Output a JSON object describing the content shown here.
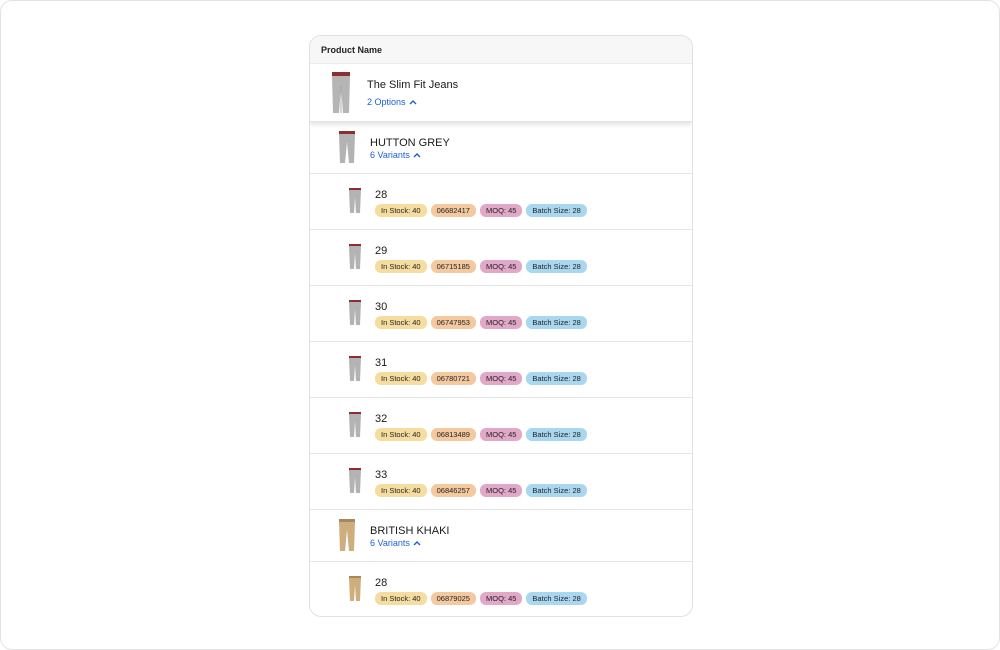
{
  "table": {
    "header": "Product Name",
    "product": {
      "name": "The Slim Fit Jeans",
      "options_link": "2 Options"
    },
    "options": [
      {
        "name": "HUTTON GREY",
        "variants_link": "6 Variants",
        "color": "grey",
        "variants": [
          {
            "size": "28",
            "stock": "In Stock: 40",
            "sku": "06682417",
            "moq": "MOQ: 45",
            "batch": "Batch Size: 28"
          },
          {
            "size": "29",
            "stock": "In Stock: 40",
            "sku": "06715185",
            "moq": "MOQ: 45",
            "batch": "Batch Size: 28"
          },
          {
            "size": "30",
            "stock": "In Stock: 40",
            "sku": "06747953",
            "moq": "MOQ: 45",
            "batch": "Batch Size: 28"
          },
          {
            "size": "31",
            "stock": "In Stock: 40",
            "sku": "06780721",
            "moq": "MOQ: 45",
            "batch": "Batch Size: 28"
          },
          {
            "size": "32",
            "stock": "In Stock: 40",
            "sku": "06813489",
            "moq": "MOQ: 45",
            "batch": "Batch Size: 28"
          },
          {
            "size": "33",
            "stock": "In Stock: 40",
            "sku": "06846257",
            "moq": "MOQ: 45",
            "batch": "Batch Size: 28"
          }
        ]
      },
      {
        "name": "BRITISH KHAKI",
        "variants_link": "6 Variants",
        "color": "khaki",
        "variants": [
          {
            "size": "28",
            "stock": "In Stock: 40",
            "sku": "06879025",
            "moq": "MOQ: 45",
            "batch": "Batch Size: 28"
          }
        ]
      }
    ]
  },
  "colors": {
    "link": "#1d5fd6",
    "badge_stock": "#f5dda0",
    "badge_sku": "#f4c9a0",
    "badge_moq": "#e1a8c8",
    "badge_batch": "#a9d7f0"
  }
}
